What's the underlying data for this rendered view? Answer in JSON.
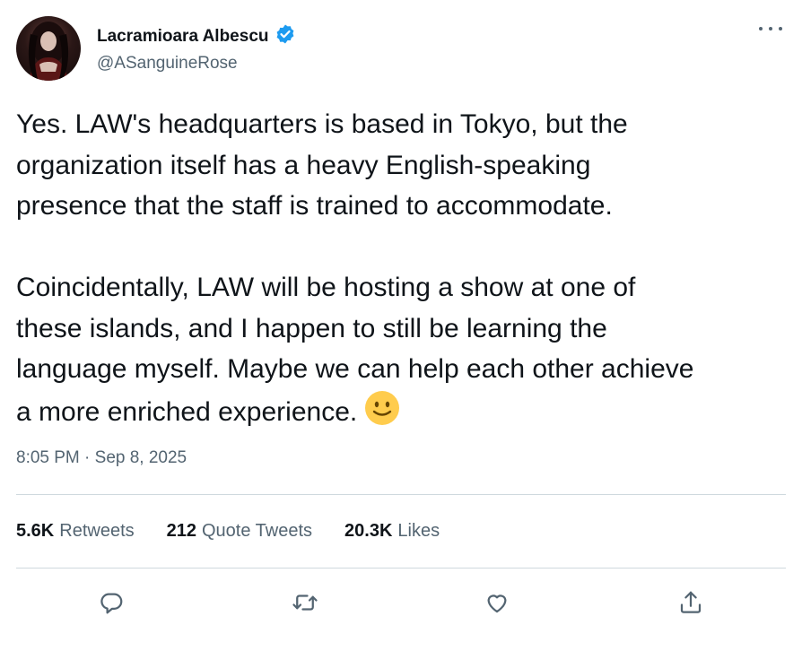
{
  "author": {
    "display_name": "Lacramioara Albescu",
    "handle": "@ASanguineRose",
    "verified": true
  },
  "tweet": {
    "text": "Yes. LAW's headquarters is based in Tokyo, but the\norganization itself has a heavy English-speaking\npresence that the staff is trained to accommodate.\n\nCoincidentally, LAW will be hosting a show at one of\nthese islands, and I happen to still be learning the\nlanguage myself. Maybe we can help each other achieve\na more enriched experience.",
    "emoji": "slightly-smiling-face",
    "timestamp": "8:05 PM · Sep 8, 2025"
  },
  "stats": {
    "retweets_count": "5.6K",
    "retweets_label": "Retweets",
    "quotes_count": "212",
    "quotes_label": "Quote Tweets",
    "likes_count": "20.3K",
    "likes_label": "Likes"
  },
  "icons": {
    "reply": "reply-icon",
    "retweet": "retweet-icon",
    "like": "like-icon",
    "share": "share-icon",
    "more": "more-icon",
    "verified": "verified-badge-icon"
  },
  "colors": {
    "text": "#0f1419",
    "secondary": "#536471",
    "verified": "#1d9bf0",
    "divider": "#cfd9de"
  }
}
